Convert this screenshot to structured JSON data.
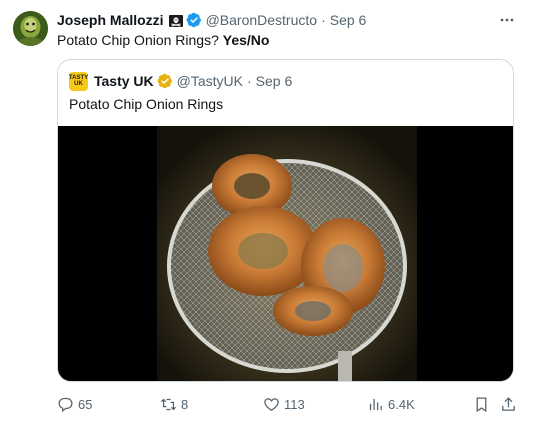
{
  "tweet": {
    "author_name": "Joseph Mallozzi",
    "author_handle": "@BaronDestructo",
    "separator": "·",
    "date": "Sep 6",
    "text_question": "Potato Chip Onion Rings?",
    "text_answer": "Yes/No",
    "avatar_icon": "profile-avatar",
    "badge_icon": "pirate-flag-icon",
    "verified_color": "#1d9bf0"
  },
  "quoted": {
    "avatar_text_line1": "TASTY",
    "avatar_text_line2": "UK",
    "author_name": "Tasty UK",
    "author_handle": "@TastyUK",
    "separator": "·",
    "date": "Sep 6",
    "text": "Potato Chip Onion Rings",
    "verified_color": "#e8b211",
    "media_description_icon": "video-thumbnail"
  },
  "actions": {
    "replies": "65",
    "retweets": "8",
    "likes": "113",
    "views": "6.4K"
  },
  "colors": {
    "text_primary": "#0f1419",
    "text_secondary": "#536471",
    "border": "#cfd9de",
    "brand_blue": "#1d9bf0"
  }
}
